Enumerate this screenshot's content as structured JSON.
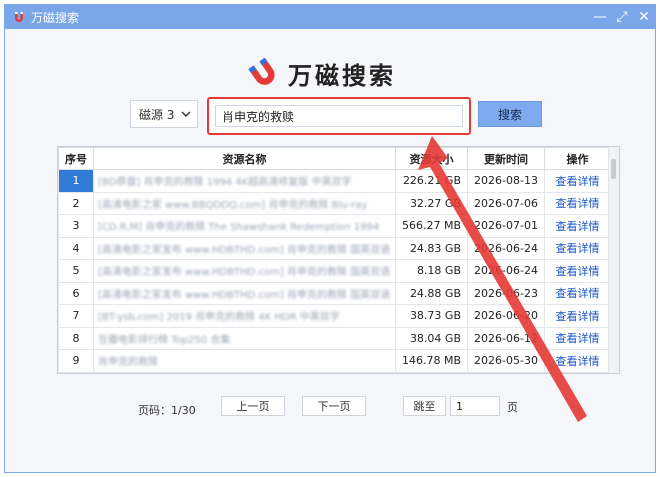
{
  "window": {
    "title": "万磁搜索",
    "controls": [
      "—",
      "⤢",
      "✕"
    ]
  },
  "brand": {
    "name": "万磁搜索"
  },
  "search": {
    "source": "磁源 3",
    "query": "肖申克的救赎",
    "button_label": "搜索"
  },
  "table": {
    "columns": [
      "序号",
      "资源名称",
      "资源大小",
      "更新时间",
      "操作"
    ],
    "rows": [
      {
        "index": "1",
        "name": "[BD原盘] 肖申克的救赎 1994 4K超高清修复版 中英双字",
        "size": "226.21 GB",
        "date": "2026-08-13",
        "action": "查看详情"
      },
      {
        "index": "2",
        "name": "[高清电影之家 www.BBQDDQ.com] 肖申克的救赎 Blu-ray",
        "size": "32.27 GB",
        "date": "2026-07-06",
        "action": "查看详情"
      },
      {
        "index": "3",
        "name": "[CD.R.M] 肖申克的救赎 The Shawshank Redemption 1994",
        "size": "566.27 MB",
        "date": "2026-07-01",
        "action": "查看详情"
      },
      {
        "index": "4",
        "name": "[高清电影之家发布 www.HDBTHD.com] 肖申克的救赎 国英双语",
        "size": "24.83 GB",
        "date": "2026-06-24",
        "action": "查看详情"
      },
      {
        "index": "5",
        "name": "[高清电影之家发布 www.HDBTHD.com] 肖申克的救赎 国英双语",
        "size": "8.18 GB",
        "date": "2026-06-24",
        "action": "查看详情"
      },
      {
        "index": "6",
        "name": "[高清电影之家发布 www.HDBTHD.com] 肖申克的救赎 国英双语",
        "size": "24.88 GB",
        "date": "2026-06-23",
        "action": "查看详情"
      },
      {
        "index": "7",
        "name": "[BT-ysb.com] 2019 肖申克的救赎 4K HDR 中英双字",
        "size": "38.73 GB",
        "date": "2026-06-20",
        "action": "查看详情"
      },
      {
        "index": "8",
        "name": "豆瓣电影排行榜 Top250 合集",
        "size": "38.04 GB",
        "date": "2026-06-12",
        "action": "查看详情"
      },
      {
        "index": "9",
        "name": "肖申克的救赎",
        "size": "146.78 MB",
        "date": "2026-05-30",
        "action": "查看详情"
      }
    ]
  },
  "pager": {
    "label": "页码：1/30",
    "prev": "上一页",
    "next": "下一页",
    "jump": "跳至",
    "page_value": "1",
    "unit": "页"
  },
  "colors": {
    "titlebar": "#7aa7ea",
    "highlight": "#e53935",
    "selected_row": "#2f7bd6",
    "link": "#1a55c5"
  },
  "icons": {
    "app": "magnet-icon",
    "logo": "magnet-logo",
    "source_dropdown": "chevron-down-icon"
  }
}
